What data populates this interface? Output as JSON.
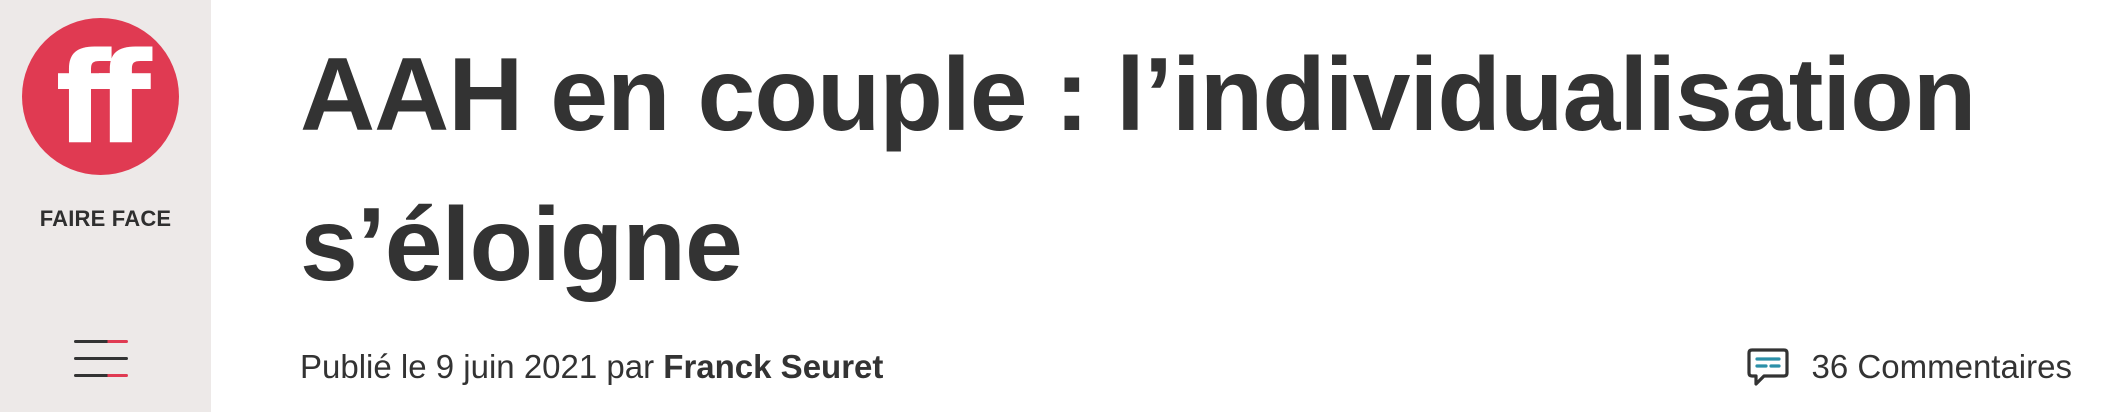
{
  "sidebar": {
    "logo": {
      "mark": "ff",
      "color": "#e03a52"
    },
    "brand_name": "FAIRE FACE",
    "menu_icon": "hamburger-menu-icon"
  },
  "article": {
    "title": "AAH en couple : l’individualisation s’éloigne",
    "meta": {
      "published_prefix": "Publié le",
      "date": "9 juin 2021",
      "by": "par",
      "author": "Franck Seuret"
    },
    "comments": {
      "icon": "comment-icon",
      "label": "36 Commentaires"
    }
  },
  "colors": {
    "sidebar_bg": "#ede9e8",
    "accent": "#e03a52",
    "text": "#333333",
    "comment_icon_accent": "#2b8fa8"
  }
}
